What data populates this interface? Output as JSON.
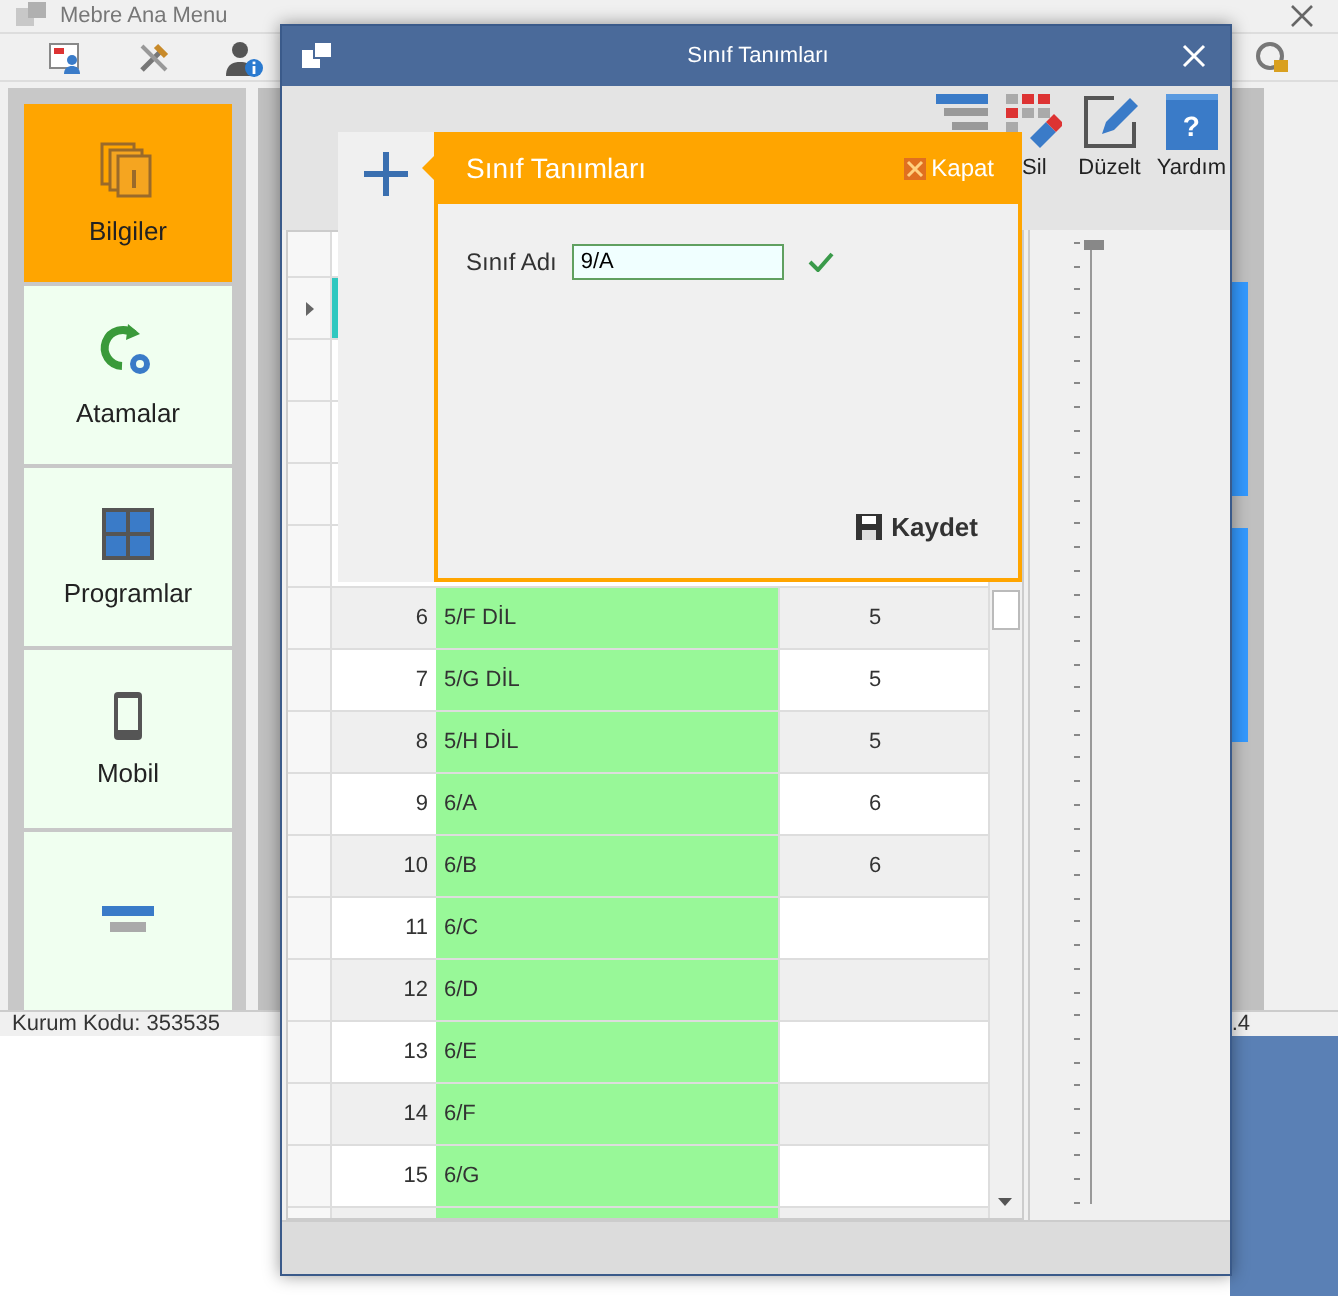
{
  "main_window": {
    "title": "Mebre Ana Menu",
    "sidebar": {
      "items": [
        {
          "kind": "info",
          "label": "Bilgiler",
          "selected": true
        },
        {
          "kind": "assign",
          "label": "Atamalar",
          "selected": false
        },
        {
          "kind": "programs",
          "label": "Programlar",
          "selected": false
        },
        {
          "kind": "mobile",
          "label": "Mobil",
          "selected": false
        },
        {
          "kind": "list",
          "selected": false
        }
      ]
    },
    "status_bar": {
      "left": "Kurum Kodu: 353535",
      "right": ".4"
    }
  },
  "dialog": {
    "title": "Sınıf Tanımları",
    "toolbar": [
      {
        "kind": "list"
      },
      {
        "kind": "delete",
        "label": "Sil"
      },
      {
        "kind": "edit",
        "label": "Düzelt"
      },
      {
        "kind": "help",
        "label": "Yardım",
        "icon_text": "?"
      }
    ],
    "grid": {
      "rows": [
        {
          "number": "6",
          "name": "5/F DİL",
          "column_3": "5"
        },
        {
          "number": "7",
          "name": "5/G DİL",
          "column_3": "5"
        },
        {
          "number": "8",
          "name": "5/H DİL",
          "column_3": "5"
        },
        {
          "number": "9",
          "name": "6/A",
          "column_3": "6"
        },
        {
          "number": "10",
          "name": "6/B",
          "column_3": "6"
        },
        {
          "number": "11",
          "name": "6/C"
        },
        {
          "number": "12",
          "name": "6/D"
        },
        {
          "number": "13",
          "name": "6/E"
        },
        {
          "number": "14",
          "name": "6/F"
        },
        {
          "number": "15",
          "name": "6/G"
        }
      ]
    },
    "slider": {
      "level": 1
    },
    "flyout": {
      "title": "Sınıf Tanımları",
      "close_label": "Kapat",
      "field_label": "Sınıf Adı",
      "field_value": "9/A",
      "save_label": "Kaydet"
    }
  }
}
